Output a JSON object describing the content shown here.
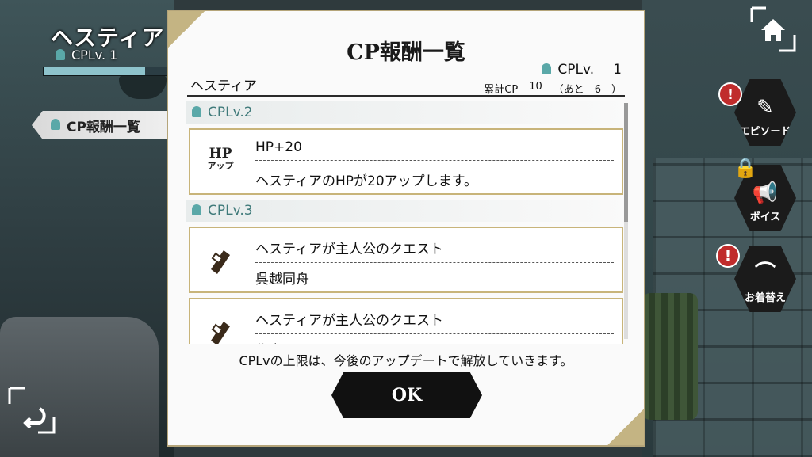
{
  "header": {
    "character_name": "ヘスティア",
    "cplv_text": "CPLv. 1",
    "cp_progress": 0.8,
    "side_tab_label": "CP報酬一覧"
  },
  "side_menu": {
    "episode_label": "エピソード",
    "voice_label": "ボイス",
    "outfit_label": "お着替え"
  },
  "modal": {
    "title": "CP報酬一覧",
    "character_name": "ヘスティア",
    "cplv_label": "CPLv.",
    "cplv_value": "1",
    "total_cp_label": "累計CP",
    "total_cp_value": "10",
    "remaining_text": "（あと　6　）",
    "levels": [
      {
        "label": "CPLv.2",
        "reward_title": "HP+20",
        "reward_desc": "ヘスティアのHPが20アップします。",
        "icon_text": "HP",
        "icon_sub": "アップ"
      },
      {
        "label": "CPLv.3",
        "reward_title": "ヘスティアが主人公のクエスト",
        "reward_desc": "呉越同舟"
      },
      {
        "reward_title": "ヘスティアが主人公のクエスト",
        "reward_desc": "秘密"
      }
    ],
    "footer_note": "CPLvの上限は、今後のアップデートで解放していきます。",
    "ok_label": "OK"
  }
}
